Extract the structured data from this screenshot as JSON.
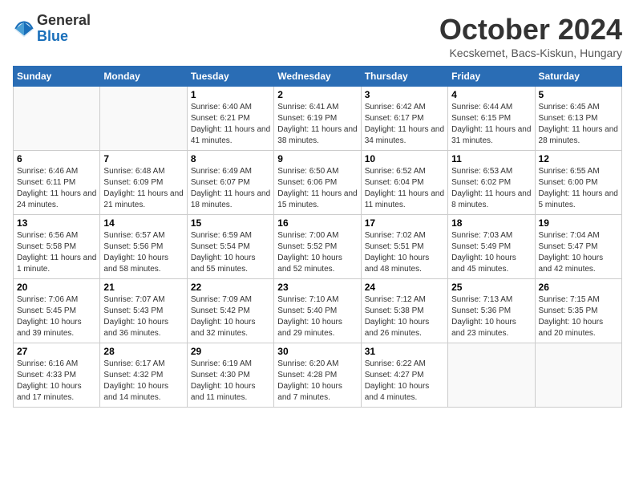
{
  "logo": {
    "general": "General",
    "blue": "Blue"
  },
  "title": "October 2024",
  "subtitle": "Kecskemet, Bacs-Kiskun, Hungary",
  "days_of_week": [
    "Sunday",
    "Monday",
    "Tuesday",
    "Wednesday",
    "Thursday",
    "Friday",
    "Saturday"
  ],
  "weeks": [
    [
      {
        "day": "",
        "info": ""
      },
      {
        "day": "",
        "info": ""
      },
      {
        "day": "1",
        "info": "Sunrise: 6:40 AM\nSunset: 6:21 PM\nDaylight: 11 hours and 41 minutes."
      },
      {
        "day": "2",
        "info": "Sunrise: 6:41 AM\nSunset: 6:19 PM\nDaylight: 11 hours and 38 minutes."
      },
      {
        "day": "3",
        "info": "Sunrise: 6:42 AM\nSunset: 6:17 PM\nDaylight: 11 hours and 34 minutes."
      },
      {
        "day": "4",
        "info": "Sunrise: 6:44 AM\nSunset: 6:15 PM\nDaylight: 11 hours and 31 minutes."
      },
      {
        "day": "5",
        "info": "Sunrise: 6:45 AM\nSunset: 6:13 PM\nDaylight: 11 hours and 28 minutes."
      }
    ],
    [
      {
        "day": "6",
        "info": "Sunrise: 6:46 AM\nSunset: 6:11 PM\nDaylight: 11 hours and 24 minutes."
      },
      {
        "day": "7",
        "info": "Sunrise: 6:48 AM\nSunset: 6:09 PM\nDaylight: 11 hours and 21 minutes."
      },
      {
        "day": "8",
        "info": "Sunrise: 6:49 AM\nSunset: 6:07 PM\nDaylight: 11 hours and 18 minutes."
      },
      {
        "day": "9",
        "info": "Sunrise: 6:50 AM\nSunset: 6:06 PM\nDaylight: 11 hours and 15 minutes."
      },
      {
        "day": "10",
        "info": "Sunrise: 6:52 AM\nSunset: 6:04 PM\nDaylight: 11 hours and 11 minutes."
      },
      {
        "day": "11",
        "info": "Sunrise: 6:53 AM\nSunset: 6:02 PM\nDaylight: 11 hours and 8 minutes."
      },
      {
        "day": "12",
        "info": "Sunrise: 6:55 AM\nSunset: 6:00 PM\nDaylight: 11 hours and 5 minutes."
      }
    ],
    [
      {
        "day": "13",
        "info": "Sunrise: 6:56 AM\nSunset: 5:58 PM\nDaylight: 11 hours and 1 minute."
      },
      {
        "day": "14",
        "info": "Sunrise: 6:57 AM\nSunset: 5:56 PM\nDaylight: 10 hours and 58 minutes."
      },
      {
        "day": "15",
        "info": "Sunrise: 6:59 AM\nSunset: 5:54 PM\nDaylight: 10 hours and 55 minutes."
      },
      {
        "day": "16",
        "info": "Sunrise: 7:00 AM\nSunset: 5:52 PM\nDaylight: 10 hours and 52 minutes."
      },
      {
        "day": "17",
        "info": "Sunrise: 7:02 AM\nSunset: 5:51 PM\nDaylight: 10 hours and 48 minutes."
      },
      {
        "day": "18",
        "info": "Sunrise: 7:03 AM\nSunset: 5:49 PM\nDaylight: 10 hours and 45 minutes."
      },
      {
        "day": "19",
        "info": "Sunrise: 7:04 AM\nSunset: 5:47 PM\nDaylight: 10 hours and 42 minutes."
      }
    ],
    [
      {
        "day": "20",
        "info": "Sunrise: 7:06 AM\nSunset: 5:45 PM\nDaylight: 10 hours and 39 minutes."
      },
      {
        "day": "21",
        "info": "Sunrise: 7:07 AM\nSunset: 5:43 PM\nDaylight: 10 hours and 36 minutes."
      },
      {
        "day": "22",
        "info": "Sunrise: 7:09 AM\nSunset: 5:42 PM\nDaylight: 10 hours and 32 minutes."
      },
      {
        "day": "23",
        "info": "Sunrise: 7:10 AM\nSunset: 5:40 PM\nDaylight: 10 hours and 29 minutes."
      },
      {
        "day": "24",
        "info": "Sunrise: 7:12 AM\nSunset: 5:38 PM\nDaylight: 10 hours and 26 minutes."
      },
      {
        "day": "25",
        "info": "Sunrise: 7:13 AM\nSunset: 5:36 PM\nDaylight: 10 hours and 23 minutes."
      },
      {
        "day": "26",
        "info": "Sunrise: 7:15 AM\nSunset: 5:35 PM\nDaylight: 10 hours and 20 minutes."
      }
    ],
    [
      {
        "day": "27",
        "info": "Sunrise: 6:16 AM\nSunset: 4:33 PM\nDaylight: 10 hours and 17 minutes."
      },
      {
        "day": "28",
        "info": "Sunrise: 6:17 AM\nSunset: 4:32 PM\nDaylight: 10 hours and 14 minutes."
      },
      {
        "day": "29",
        "info": "Sunrise: 6:19 AM\nSunset: 4:30 PM\nDaylight: 10 hours and 11 minutes."
      },
      {
        "day": "30",
        "info": "Sunrise: 6:20 AM\nSunset: 4:28 PM\nDaylight: 10 hours and 7 minutes."
      },
      {
        "day": "31",
        "info": "Sunrise: 6:22 AM\nSunset: 4:27 PM\nDaylight: 10 hours and 4 minutes."
      },
      {
        "day": "",
        "info": ""
      },
      {
        "day": "",
        "info": ""
      }
    ]
  ]
}
